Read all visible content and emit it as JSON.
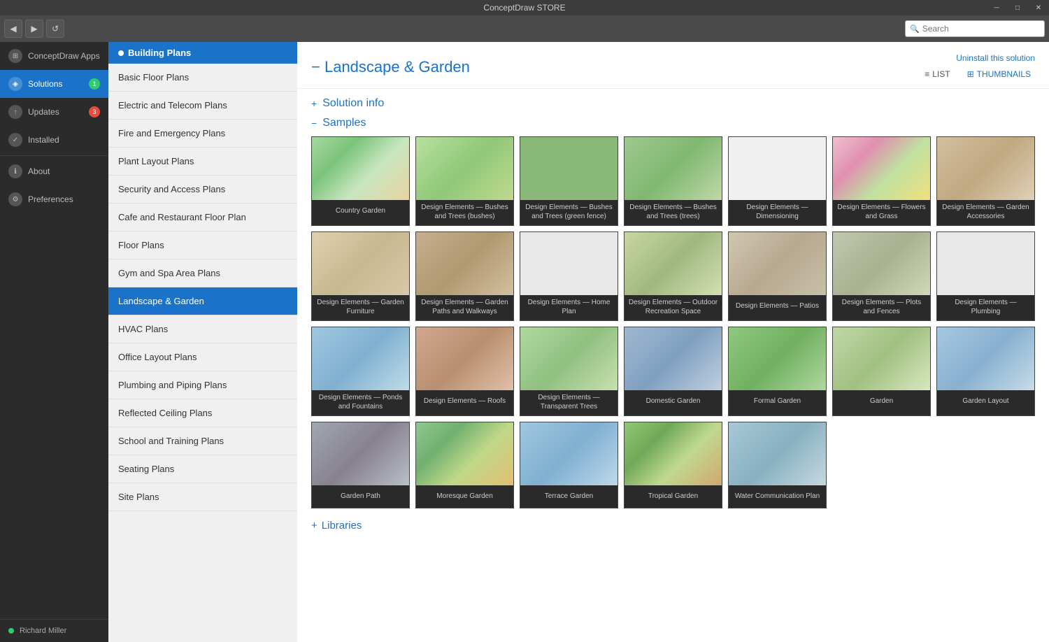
{
  "window": {
    "title": "ConceptDraw STORE",
    "min_btn": "─",
    "max_btn": "□",
    "close_btn": "✕"
  },
  "toolbar": {
    "back_label": "◀",
    "forward_label": "▶",
    "refresh_label": "↺",
    "search_placeholder": "Search"
  },
  "sidebar": {
    "items": [
      {
        "id": "apps",
        "label": "ConceptDraw Apps",
        "icon": "⊞",
        "badge": null
      },
      {
        "id": "solutions",
        "label": "Solutions",
        "icon": "◈",
        "badge": "1",
        "badge_color": "green",
        "active": true
      },
      {
        "id": "updates",
        "label": "Updates",
        "icon": "↑",
        "badge": "3",
        "badge_color": "red"
      },
      {
        "id": "installed",
        "label": "Installed",
        "icon": "✓",
        "badge": null
      },
      {
        "id": "about",
        "label": "About",
        "icon": "ℹ",
        "badge": null
      },
      {
        "id": "preferences",
        "label": "Preferences",
        "icon": "⚙",
        "badge": null
      }
    ],
    "user": {
      "name": "Richard Miller",
      "dot_color": "#2ecc71"
    }
  },
  "nav_panel": {
    "category": "Building Plans",
    "items": [
      {
        "id": "basic-floor",
        "label": "Basic Floor Plans"
      },
      {
        "id": "electric",
        "label": "Electric and Telecom Plans"
      },
      {
        "id": "fire",
        "label": "Fire and Emergency Plans"
      },
      {
        "id": "plant",
        "label": "Plant Layout Plans"
      },
      {
        "id": "security",
        "label": "Security and Access Plans"
      },
      {
        "id": "cafe",
        "label": "Cafe and Restaurant Floor Plan"
      },
      {
        "id": "floor",
        "label": "Floor Plans"
      },
      {
        "id": "gym",
        "label": "Gym and Spa Area Plans"
      },
      {
        "id": "landscape",
        "label": "Landscape & Garden",
        "active": true
      },
      {
        "id": "hvac",
        "label": "HVAC Plans"
      },
      {
        "id": "office",
        "label": "Office Layout Plans"
      },
      {
        "id": "plumbing",
        "label": "Plumbing and Piping Plans"
      },
      {
        "id": "reflected",
        "label": "Reflected Ceiling Plans"
      },
      {
        "id": "school",
        "label": "School and Training Plans"
      },
      {
        "id": "seating",
        "label": "Seating Plans"
      },
      {
        "id": "site",
        "label": "Site Plans"
      }
    ]
  },
  "content": {
    "title": "Landscape & Garden",
    "uninstall_label": "Uninstall this solution",
    "view_list_label": "LIST",
    "view_thumbnails_label": "THUMBNAILS",
    "solution_info_label": "Solution info",
    "samples_label": "Samples",
    "libraries_label": "Libraries",
    "thumbnails": [
      {
        "id": "country-garden",
        "label": "Country Garden",
        "pattern": "pattern-garden"
      },
      {
        "id": "bushes-bushes",
        "label": "Design Elements — Bushes and Trees (bushes)",
        "pattern": "pattern-bushes-bushes"
      },
      {
        "id": "bushes-green",
        "label": "Design Elements — Bushes and Trees (green fence)",
        "pattern": "pattern-bushes-green"
      },
      {
        "id": "bushes-trees",
        "label": "Design Elements — Bushes and Trees (trees)",
        "pattern": "pattern-bushes-trees"
      },
      {
        "id": "dimensioning",
        "label": "Design Elements — Dimensioning",
        "pattern": "pattern-dimensioning"
      },
      {
        "id": "flowers",
        "label": "Design Elements — Flowers and Grass",
        "pattern": "pattern-flowers"
      },
      {
        "id": "accessories",
        "label": "Design Elements — Garden Accessories",
        "pattern": "pattern-accessories"
      },
      {
        "id": "furniture",
        "label": "Design Elements — Garden Furniture",
        "pattern": "pattern-furniture"
      },
      {
        "id": "paths",
        "label": "Design Elements — Garden Paths and Walkways",
        "pattern": "pattern-paths"
      },
      {
        "id": "home-plan",
        "label": "Design Elements — Home Plan",
        "pattern": "pattern-home"
      },
      {
        "id": "outdoor",
        "label": "Design Elements — Outdoor Recreation Space",
        "pattern": "pattern-outdoor"
      },
      {
        "id": "patios",
        "label": "Design Elements — Patios",
        "pattern": "pattern-patios"
      },
      {
        "id": "plots",
        "label": "Design Elements — Plots and Fences",
        "pattern": "pattern-plots"
      },
      {
        "id": "plumbing-de",
        "label": "Design Elements — Plumbing",
        "pattern": "pattern-plumbing"
      },
      {
        "id": "ponds",
        "label": "Design Elements — Ponds and Fountains",
        "pattern": "pattern-ponds"
      },
      {
        "id": "roofs",
        "label": "Design Elements — Roofs",
        "pattern": "pattern-roofs"
      },
      {
        "id": "transparent",
        "label": "Design Elements — Transparent Trees",
        "pattern": "pattern-transparent"
      },
      {
        "id": "domestic",
        "label": "Domestic Garden",
        "pattern": "pattern-domestic"
      },
      {
        "id": "formal",
        "label": "Formal Garden",
        "pattern": "pattern-formal"
      },
      {
        "id": "garden-main",
        "label": "Garden",
        "pattern": "pattern-garden-main"
      },
      {
        "id": "layout",
        "label": "Garden Layout",
        "pattern": "pattern-layout"
      },
      {
        "id": "garden-path",
        "label": "Garden Path",
        "pattern": "pattern-garden-path"
      },
      {
        "id": "moresque",
        "label": "Moresque Garden",
        "pattern": "pattern-moresque"
      },
      {
        "id": "terrace",
        "label": "Terrace Garden",
        "pattern": "pattern-terrace"
      },
      {
        "id": "tropical",
        "label": "Tropical Garden",
        "pattern": "pattern-tropical"
      },
      {
        "id": "water-comm",
        "label": "Water Communication Plan",
        "pattern": "pattern-water"
      }
    ]
  }
}
